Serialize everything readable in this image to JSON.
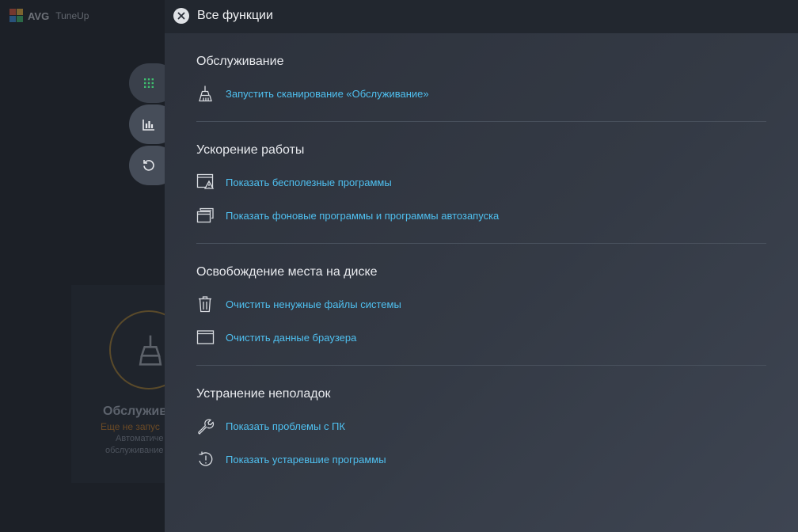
{
  "app": {
    "logo_avg": "AVG",
    "logo_tuneup": "TuneUp"
  },
  "background_card": {
    "title": "Обслужив",
    "status": "Еще не запус",
    "desc_line1": "Автоматиче",
    "desc_line2": "обслуживание"
  },
  "side_nav": [
    {
      "icon": "apps-grid-icon"
    },
    {
      "icon": "bar-chart-icon"
    },
    {
      "icon": "restore-icon"
    }
  ],
  "panel": {
    "title": "Все функции",
    "close_icon": "close-icon",
    "sections": [
      {
        "title": "Обслуживание",
        "items": [
          {
            "label": "Запустить сканирование «Обслуживание»",
            "icon": "broom-icon"
          }
        ]
      },
      {
        "title": "Ускорение работы",
        "items": [
          {
            "label": "Показать бесполезные программы",
            "icon": "window-warning-icon"
          },
          {
            "label": "Показать фоновые программы и программы автозапуска",
            "icon": "stacked-windows-icon"
          }
        ]
      },
      {
        "title": "Освобождение места на диске",
        "items": [
          {
            "label": "Очистить ненужные файлы системы",
            "icon": "trash-icon"
          },
          {
            "label": "Очистить данные браузера",
            "icon": "browser-window-icon"
          }
        ]
      },
      {
        "title": "Устранение неполадок",
        "items": [
          {
            "label": "Показать проблемы с ПК",
            "icon": "wrench-icon"
          },
          {
            "label": "Показать устаревшие программы",
            "icon": "update-alert-icon"
          }
        ]
      }
    ]
  },
  "colors": {
    "link": "#4fc0f0",
    "panel_header": "#22272f",
    "accent_green": "#3fbf6f"
  }
}
